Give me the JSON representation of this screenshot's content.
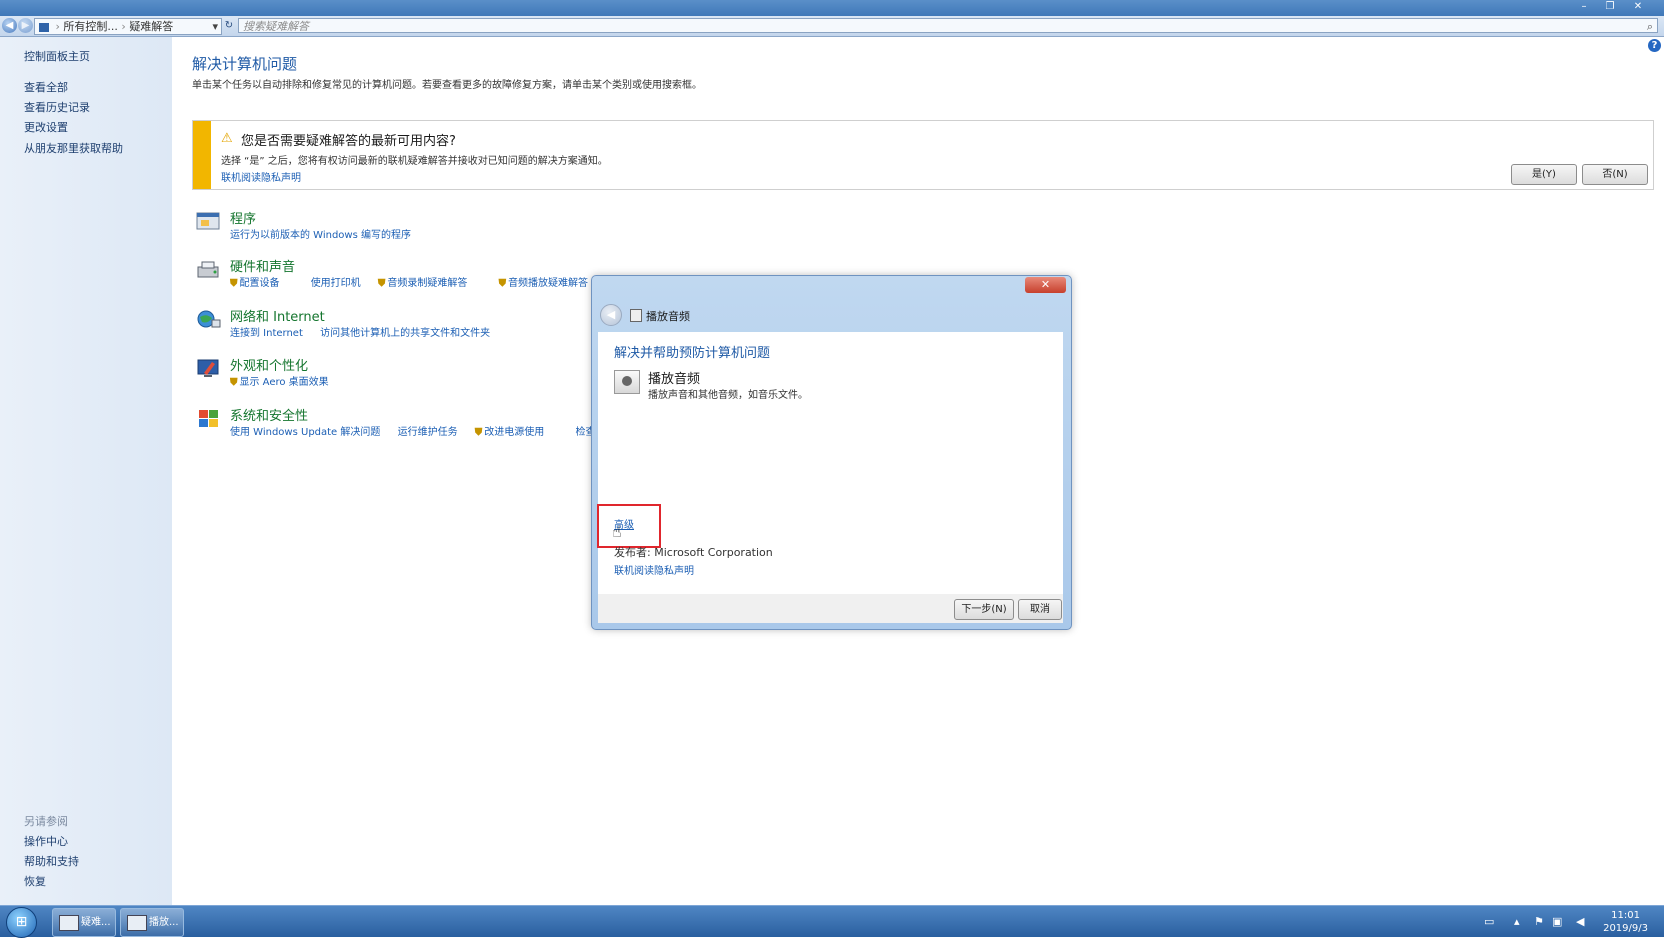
{
  "window": {
    "titlebar_buttons": [
      "–",
      "❐",
      "✕"
    ]
  },
  "address_bar": {
    "crumbs": [
      "所有控制...",
      "疑难解答"
    ],
    "search_placeholder": "搜索疑难解答"
  },
  "left_pane": {
    "home_link": "控制面板主页",
    "links": [
      "查看全部",
      "查看历史记录",
      "更改设置",
      "从朋友那里获取帮助"
    ],
    "see_also_header": "另请参阅",
    "see_also": [
      "操作中心",
      "帮助和支持",
      "恢复"
    ]
  },
  "main": {
    "title": "解决计算机问题",
    "description": "单击某个任务以自动排除和修复常见的计算机问题。若要查看更多的故障修复方案，请单击某个类别或使用搜索框。",
    "notice": {
      "title": "您是否需要疑难解答的最新可用内容?",
      "description": "选择 “是” 之后，您将有权访问最新的联机疑难解答并接收对已知问题的解决方案通知。",
      "privacy_link": "联机阅读隐私声明",
      "yes_button": "是(Y)",
      "no_button": "否(N)"
    },
    "categories": [
      {
        "title": "程序",
        "links": [
          "运行为以前版本的 Windows 编写的程序"
        ]
      },
      {
        "title": "硬件和声音",
        "links": [
          "配置设备",
          "使用打印机",
          "音频录制疑难解答",
          "音频播放疑难解答"
        ]
      },
      {
        "title": "网络和 Internet",
        "links": [
          "连接到 Internet",
          "访问其他计算机上的共享文件和文件夹"
        ]
      },
      {
        "title": "外观和个性化",
        "links": [
          "显示 Aero 桌面效果"
        ]
      },
      {
        "title": "系统和安全性",
        "links": [
          "使用 Windows Update 解决问题",
          "运行维护任务",
          "改进电源使用",
          "检查性"
        ]
      }
    ]
  },
  "dialog": {
    "close": "✕",
    "title": "播放音频",
    "heading": "解决并帮助预防计算机问题",
    "item_title": "播放音频",
    "item_description": "播放声音和其他音频，如音乐文件。",
    "advanced_link": "高级",
    "publisher_label": "发布者:",
    "publisher_value": "Microsoft Corporation",
    "privacy_link": "联机阅读隐私声明",
    "next_button": "下一步(N)",
    "cancel_button": "取消"
  },
  "taskbar": {
    "items": [
      "疑难...",
      "播放..."
    ],
    "time": "11:01",
    "date": "2019/9/3"
  },
  "colors": {
    "accent_blue": "#1f5aa6",
    "category_green": "#14752e",
    "notice_yellow": "#f2b600",
    "highlight_red": "#e0262d"
  }
}
